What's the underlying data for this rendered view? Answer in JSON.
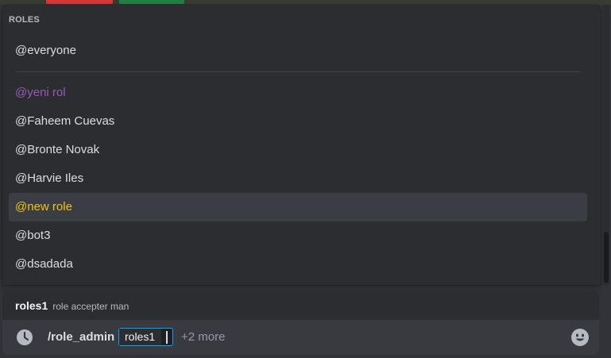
{
  "popup": {
    "header": "ROLES",
    "everyone": "@everyone",
    "roles": [
      {
        "label": "@yeni rol",
        "color": "#9b59b6"
      },
      {
        "label": "@Faheem Cuevas",
        "color": "#dbdee1"
      },
      {
        "label": "@Bronte Novak",
        "color": "#dbdee1"
      },
      {
        "label": "@Harvie Iles",
        "color": "#dbdee1"
      },
      {
        "label": "@new role",
        "color": "#f1c40f",
        "selected": true
      },
      {
        "label": "@bot3",
        "color": "#dbdee1"
      },
      {
        "label": "@dsadada",
        "color": "#dbdee1"
      }
    ]
  },
  "hint": {
    "option_name": "roles1",
    "option_description": "role accepter man"
  },
  "input": {
    "command": "/role_admin",
    "param_label": "roles1",
    "more": "+2 more",
    "clock_icon": "clock-icon",
    "emoji_icon": "smiley-emoji-icon"
  },
  "colors": {
    "accent": "#00a8fc",
    "background": "#313338",
    "popup_bg": "#2b2d31",
    "input_bg": "#383a40"
  }
}
